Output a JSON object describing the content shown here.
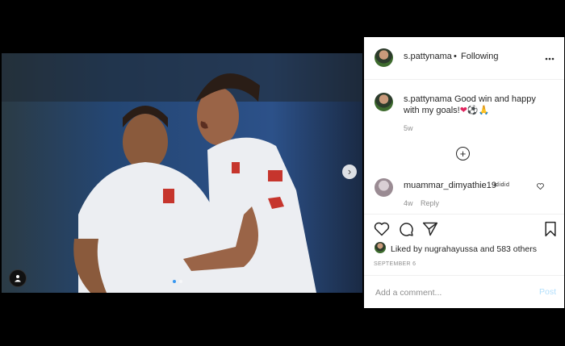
{
  "post": {
    "username": "s.pattynama",
    "follow_sep": "•",
    "follow_status": "Following",
    "more_icon": "more-horizontal-icon",
    "caption": "s.pattynama Good win and happy with my goals!❤️⚽🙏🏾",
    "caption_user": "s.pattynama",
    "caption_text": " Good win and happy with my goals!",
    "caption_time": "5w",
    "load_more": "+",
    "comment": {
      "username": "muammar_dimyathie19",
      "text": "ididid",
      "time": "4w",
      "reply_label": "Reply"
    },
    "likes": {
      "liked_by_prefix": "Liked by ",
      "liked_by_user": "nugrahayussa",
      "liked_by_mid": " and ",
      "others": "583 others"
    },
    "date": "SEPTEMBER 6",
    "comment_placeholder": "Add a comment...",
    "post_label": "Post",
    "carousel_next": "›"
  },
  "colors": {
    "accent_blue": "#3897f0",
    "post_disabled": "#b2dffc",
    "muted_text": "#8e8e8e"
  }
}
